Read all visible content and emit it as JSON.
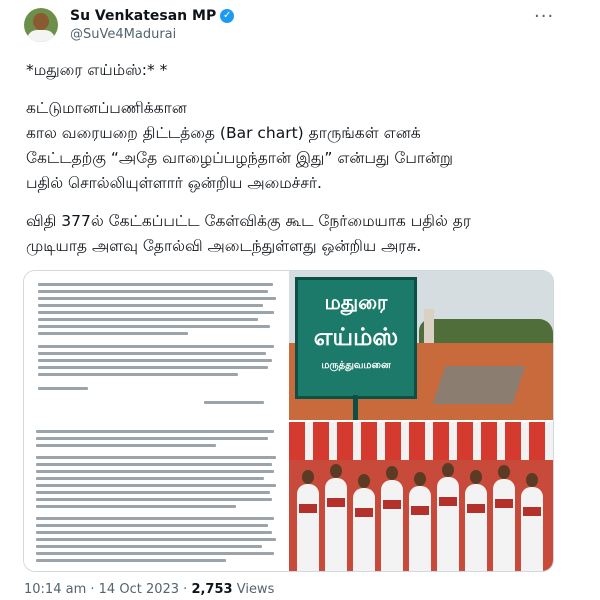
{
  "author": {
    "display_name": "Su Venkatesan MP",
    "handle": "@SuVe4Madurai",
    "verified_icon": "verified-badge-icon",
    "accent": "#1d9bf0"
  },
  "menu": {
    "more_label": "···"
  },
  "tweet": {
    "line_title": "*மதுரை எய்ம்ஸ்:* *",
    "paragraph_1": "கட்டுமானப்பணிக்கான\nகால வரையறை திட்டத்தை (Bar chart) தாருங்கள் எனக்\nகேட்டதற்கு “அதே வாழைப்பழந்தான் இது” என்பது போன்று\nபதில் சொல்லியுள்ளார் ஒன்றிய அமைச்சர்.",
    "paragraph_2": "விதி 377ல் கேட்கப்பட்ட கேள்விக்கு கூட நேர்மையாக பதில் தர\nமுடியாத அளவு தோல்வி அடைந்துள்ளது ஒன்றிய அரசு."
  },
  "media": {
    "sign_line_1": "மதுரை",
    "sign_line_2": "எய்ம்ஸ்",
    "sign_line_3": "மருத்துவமனை"
  },
  "footer": {
    "time": "10:14 am",
    "date": "14 Oct 2023",
    "views_count": "2,753",
    "views_label": "Views",
    "separator": "·"
  }
}
